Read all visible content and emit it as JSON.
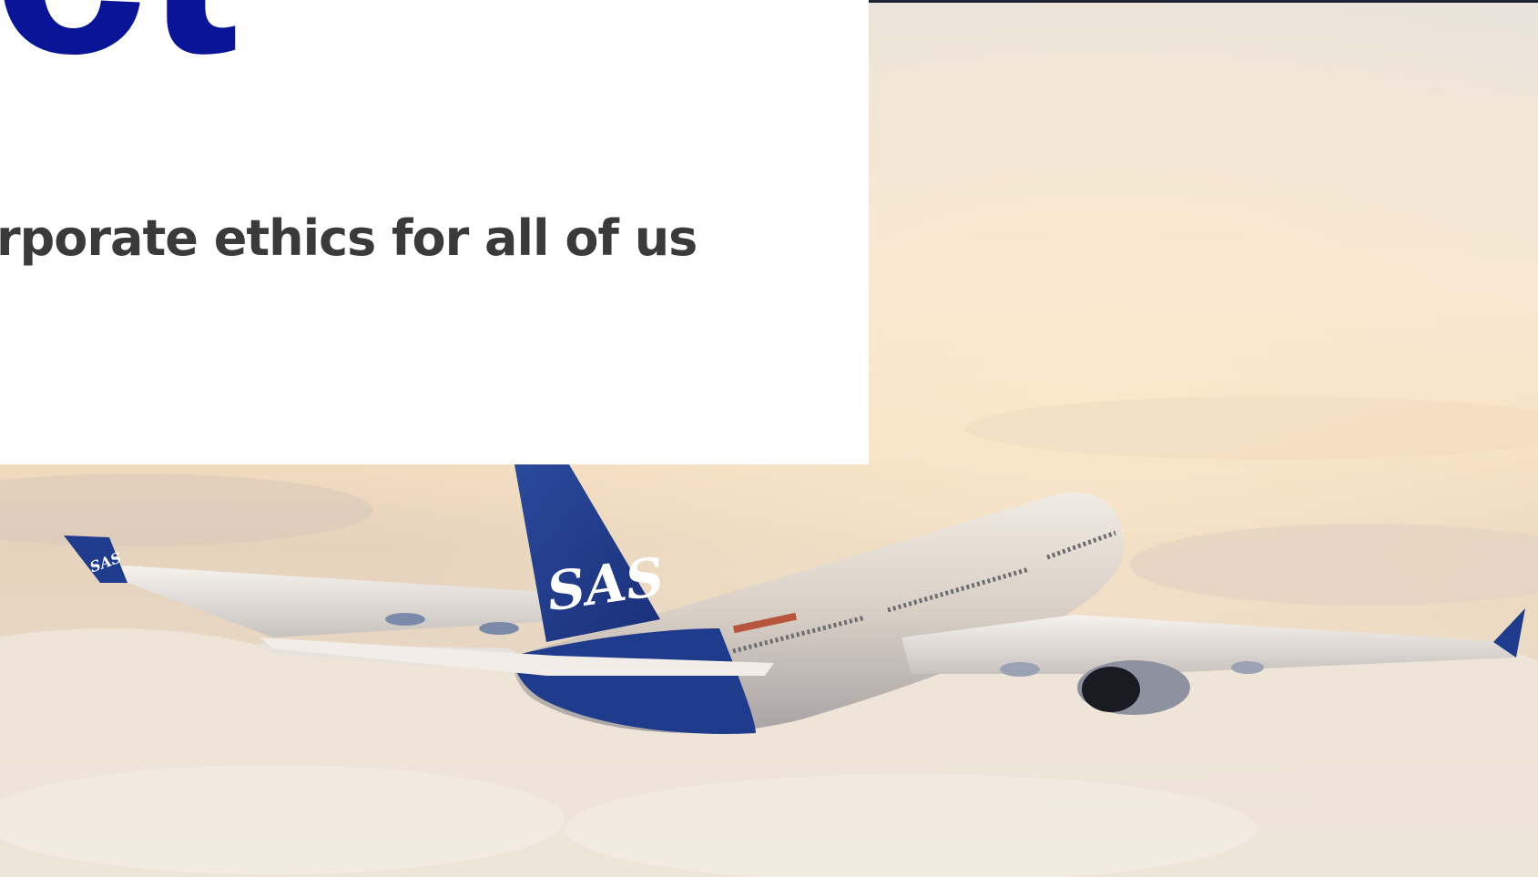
{
  "heading": {
    "title": "nct",
    "subtitle": "rporate ethics for all of us"
  },
  "hero_image": {
    "tail_logo_text": "SAS",
    "winglet_logo_text": "SAS",
    "colors": {
      "brand_blue": "#0a1496",
      "tail_blue": "#1f3c8c",
      "sky": "#f4e7d4"
    }
  }
}
